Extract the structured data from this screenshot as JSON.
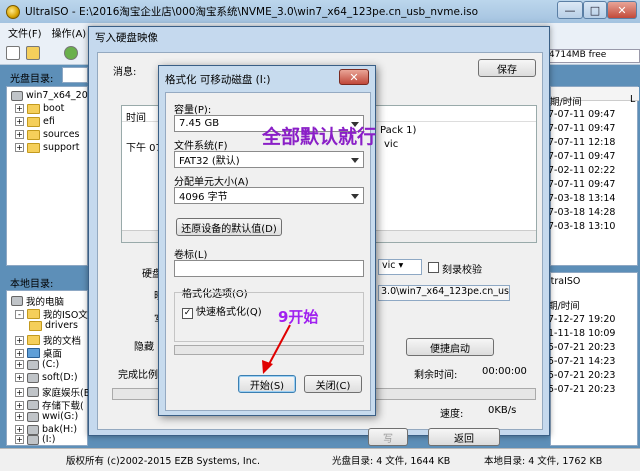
{
  "app": {
    "title": "UltraISO - E:\\2016淘宝企业店\\000淘宝系统\\NVME_3.0\\win7_x64_123pe.cn_usb_nvme.iso"
  },
  "menu": [
    "文件(F)",
    "操作(A)"
  ],
  "toolbar": {
    "info": "/ 4714MB free"
  },
  "disc_dir": {
    "label": "光盘目录:",
    "tree": [
      "win7_x64_2018",
      "boot",
      "efi",
      "sources",
      "support"
    ]
  },
  "right_list": {
    "header": "期/时间",
    "header2": "L",
    "rows": [
      "7-07-11 09:47",
      "7-07-11 09:47",
      "7-07-11 12:18",
      "7-07-11 09:47",
      "7-02-11 02:22",
      "7-07-11 09:47",
      "7-03-18 13:14",
      "7-03-18 14:28",
      "7-03-18 13:10"
    ],
    "lower_header": "ltraISO",
    "lower_rows": [
      "期/时间",
      "7-12-27 19:20",
      "1-11-18 10:09",
      "5-07-21 20:23",
      "5-07-21 14:23",
      "5-07-21 20:23",
      "5-07-21 20:23"
    ]
  },
  "local_dir": {
    "label": "本地目录:",
    "tree": [
      "我的电脑",
      "我的ISO文档",
      "drivers",
      "我的文档",
      "桌面",
      "(C:)",
      "soft(D:)",
      "家庭娱乐(E",
      "存储下载(",
      "wwi(G:)",
      "bak(H:)",
      "(I:)"
    ]
  },
  "status": {
    "copyright": "版权所有 (c)2002-2015 EZB Systems, Inc.",
    "disc": "光盘目录: 4 文件, 1644 KB",
    "local": "本地目录: 4 文件, 1762 KB"
  },
  "write_dialog": {
    "title": "写入硬盘映像",
    "msg_label": "消息:",
    "save": "保存",
    "col_time": "时间",
    "row_time": "下午 07:3",
    "pack": "Pack 1)",
    "vic": "vic",
    "hdd": "硬盘",
    "img": "映",
    "write_label": "写",
    "hide": "隐藏",
    "done": "完成比例",
    "vic_sel": "vic",
    "verify": "刻录校验",
    "path": "3.0\\win7_x64_123pe.cn_us",
    "boot_btn": "便捷启动",
    "remaining": "剩余时间:",
    "remaining_val": "00:00:00",
    "speed": "速度:",
    "speed_val": "0KB/s",
    "back": "返回"
  },
  "format_dialog": {
    "title": "格式化 可移动磁盘 (I:)",
    "capacity_label": "容量(P):",
    "capacity_value": "7.45 GB",
    "fs_label": "文件系统(F)",
    "fs_value": "FAT32 (默认)",
    "alloc_label": "分配单元大小(A)",
    "alloc_value": "4096 字节",
    "restore": "还原设备的默认值(D)",
    "vol_label": "卷标(L)",
    "vol_value": "",
    "options_label": "格式化选项(O)",
    "quick_format": "快速格式化(Q)",
    "start": "开始(S)",
    "close": "关闭(C)"
  },
  "annotations": {
    "default_note": "全部默认就行",
    "start_note": "9开始"
  }
}
